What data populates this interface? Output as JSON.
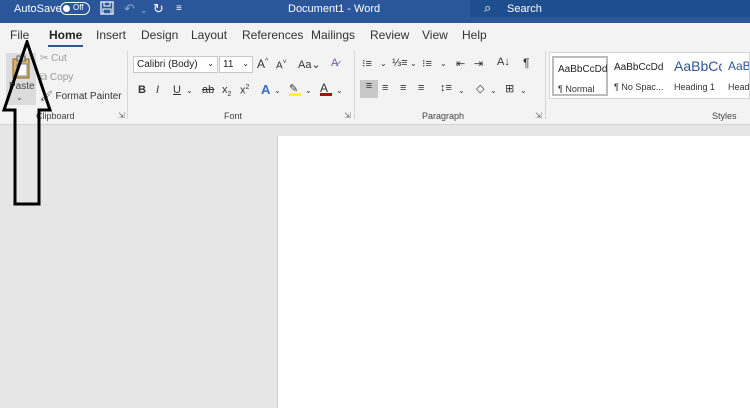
{
  "titlebar": {
    "autosave_label": "AutoSave",
    "autosave_state": "Off",
    "doc_title": "Document1  -  Word",
    "search_label": "Search",
    "icons": [
      "save-icon",
      "undo-icon",
      "redo-icon",
      "customize-qat-icon"
    ]
  },
  "tabs": [
    {
      "label": "File"
    },
    {
      "label": "Home"
    },
    {
      "label": "Insert"
    },
    {
      "label": "Design"
    },
    {
      "label": "Layout"
    },
    {
      "label": "References"
    },
    {
      "label": "Mailings"
    },
    {
      "label": "Review"
    },
    {
      "label": "View"
    },
    {
      "label": "Help"
    }
  ],
  "ribbon": {
    "clipboard": {
      "paste_label": "Paste",
      "cut_label": "Cut",
      "copy_label": "Copy",
      "format_painter_label": "Format Painter",
      "group_label": "Clipboard"
    },
    "font": {
      "font_name": "Calibri (Body)",
      "font_size": "11",
      "group_label": "Font"
    },
    "paragraph": {
      "group_label": "Paragraph"
    },
    "styles": {
      "group_label": "Styles",
      "items": [
        {
          "sample": "AaBbCcDd",
          "name": "¶ Normal"
        },
        {
          "sample": "AaBbCcDd",
          "name": "¶ No Spac..."
        },
        {
          "sample": "AaBbCc",
          "name": "Heading 1"
        },
        {
          "sample": "AaBb",
          "name": "Headi"
        }
      ]
    }
  },
  "colors": {
    "accent": "#2b579a",
    "highlight": "#ffff00",
    "font_color": "#c00000"
  }
}
